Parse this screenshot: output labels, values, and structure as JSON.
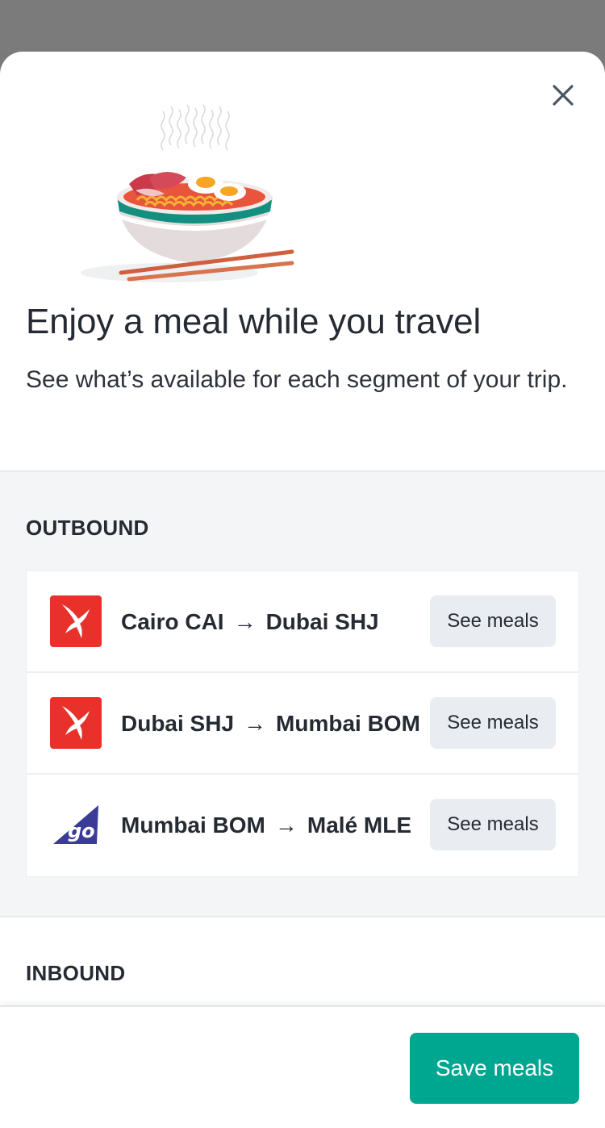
{
  "header": {
    "close_icon": "close-icon",
    "illustration": "noodle-bowl-illustration",
    "title": "Enjoy a meal while you travel",
    "subtitle": "See what’s available for each segment of your trip."
  },
  "outbound": {
    "title": "OUTBOUND",
    "segments": [
      {
        "from": "Cairo CAI",
        "arrow": "→",
        "to": "Dubai SHJ",
        "airline_logo": "air-arabia-logo",
        "button_label": "See meals"
      },
      {
        "from": "Dubai SHJ",
        "arrow": "→",
        "to": "Mumbai BOM",
        "airline_logo": "air-arabia-logo",
        "button_label": "See meals"
      },
      {
        "from": "Mumbai BOM",
        "arrow": "→",
        "to": "Malé MLE",
        "airline_logo": "go-air-logo",
        "button_label": "See meals"
      }
    ]
  },
  "inbound": {
    "title": "INBOUND"
  },
  "footer": {
    "save_label": "Save meals"
  },
  "colors": {
    "accent": "#00a790",
    "air_arabia_red": "#e8312b",
    "go_air_blue": "#3b3c97",
    "text": "#262b33",
    "section_bg": "#f4f5f7",
    "button_bg": "#e9edf1"
  }
}
